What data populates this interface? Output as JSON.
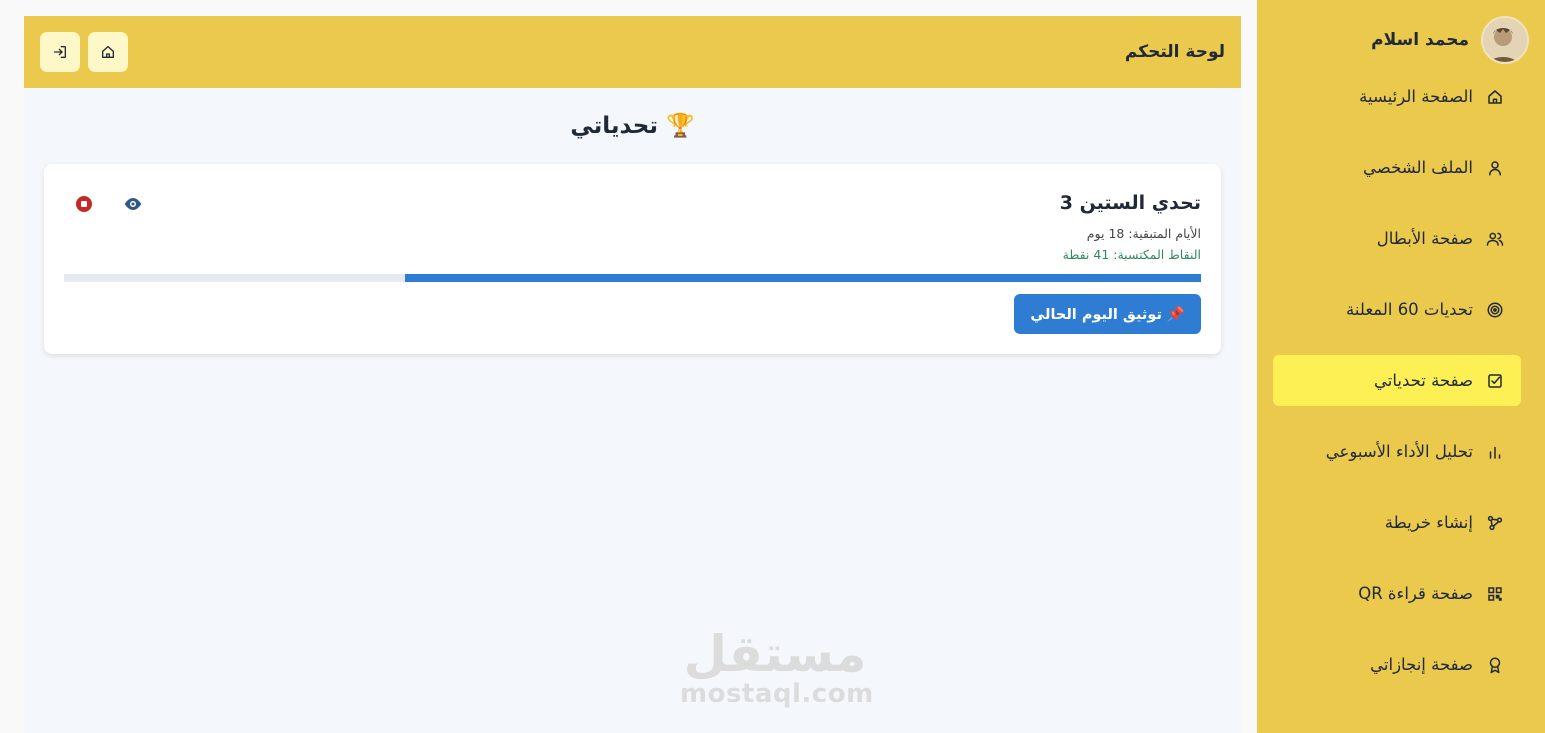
{
  "header": {
    "title": "لوحة التحكم"
  },
  "page": {
    "heading": "🏆 تحدياتي"
  },
  "challenge": {
    "title": "تحدي الستين 3",
    "days_remaining": "الأيام المتبقية: 18 يوم",
    "points_earned": "النقاط المكتسبة: 41 نقطة",
    "progress_fraction": 0.7,
    "record_button": "📌 توثيق اليوم الحالي"
  },
  "user": {
    "name": "محمد اسلام"
  },
  "sidebar": {
    "items": [
      {
        "label": "الصفحة الرئيسية",
        "icon": "home-icon"
      },
      {
        "label": "الملف الشخصي",
        "icon": "user-icon"
      },
      {
        "label": "صفحة الأبطال",
        "icon": "users-icon"
      },
      {
        "label": "تحديات 60 المعلنة",
        "icon": "target-icon"
      },
      {
        "label": "صفحة تحدياتي",
        "icon": "checkbox-icon",
        "active": true
      },
      {
        "label": "تحليل الأداء الأسبوعي",
        "icon": "bar-chart-icon"
      },
      {
        "label": "إنشاء خريطة",
        "icon": "graph-nodes-icon"
      },
      {
        "label": "صفحة قراءة QR",
        "icon": "qr-code-icon"
      },
      {
        "label": "صفحة إنجازاتي",
        "icon": "award-icon"
      }
    ]
  },
  "watermark": {
    "ar": "مستقل",
    "en": "mostaql.com"
  },
  "colors": {
    "accent_yellow": "#ebc94c",
    "active_item": "#fdf054",
    "primary_blue": "#2f7dd3",
    "stop_red": "#c62828"
  }
}
